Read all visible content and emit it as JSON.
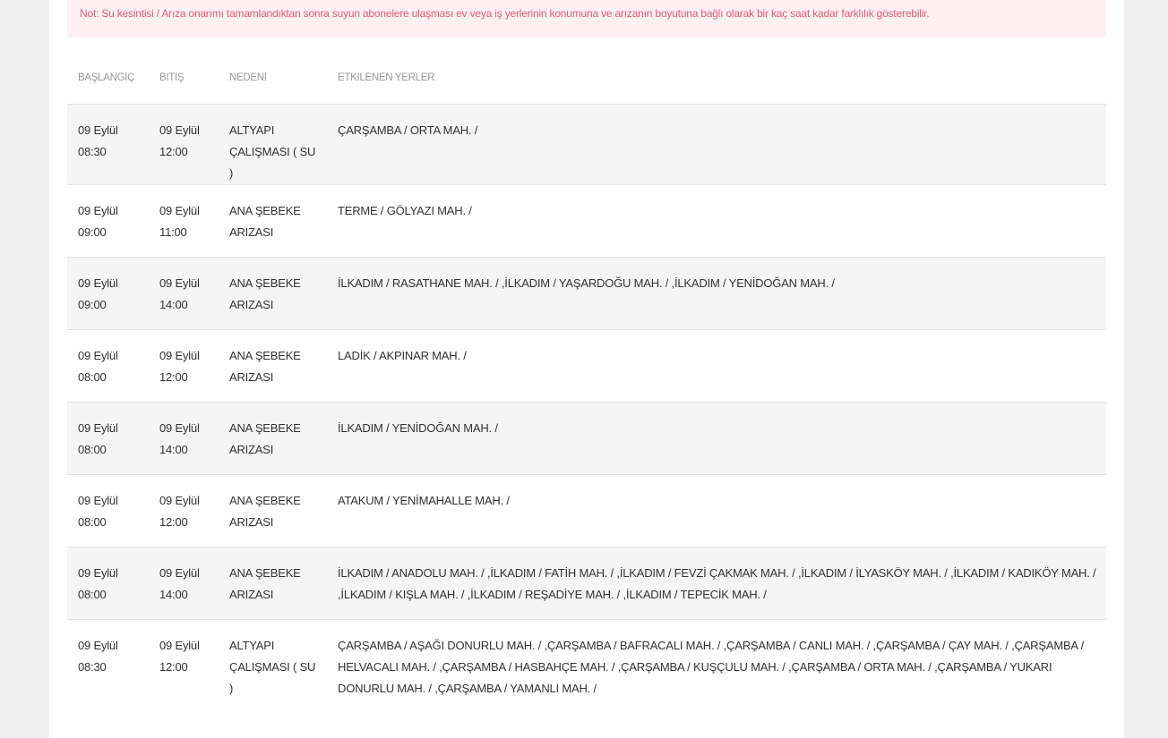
{
  "notice": {
    "text": "Not: Su kesintisi / Arıza onarımı tamamlandıktan sonra suyun abonelere ulaşması ev veya iş yerlerinin konumuna ve arızanın boyutuna bağlı olarak bir kaç saat kadar farklılık gösterebilir."
  },
  "table": {
    "headers": {
      "start": "BAŞLANGIÇ",
      "end": "BITIŞ",
      "reason": "NEDENI",
      "places": "ETKILENEN YERLER"
    },
    "rows": [
      {
        "start_date": "09 Eylül",
        "start_time": "08:30",
        "end_date": "09 Eylül",
        "end_time": "12:00",
        "reason_1": "ALTYAPI",
        "reason_2": "ÇALIŞMASI ( SU )",
        "places": "ÇARŞAMBA / ORTA MAH. /"
      },
      {
        "start_date": "09 Eylül",
        "start_time": "09:00",
        "end_date": "09 Eylül",
        "end_time": "11:00",
        "reason_1": "ANA ŞEBEKE",
        "reason_2": "ARIZASI",
        "places": "TERME / GÖLYAZI MAH. /"
      },
      {
        "start_date": "09 Eylül",
        "start_time": "09:00",
        "end_date": "09 Eylül",
        "end_time": "14:00",
        "reason_1": "ANA ŞEBEKE",
        "reason_2": "ARIZASI",
        "places": "İLKADIM / RASATHANE MAH. / ,İLKADIM / YAŞARDOĞU MAH. / ,İLKADIM / YENİDOĞAN MAH. /"
      },
      {
        "start_date": "09 Eylül",
        "start_time": "08:00",
        "end_date": "09 Eylül",
        "end_time": "12:00",
        "reason_1": "ANA ŞEBEKE",
        "reason_2": "ARIZASI",
        "places": "LADİK / AKPINAR MAH. /"
      },
      {
        "start_date": "09 Eylül",
        "start_time": "08:00",
        "end_date": "09 Eylül",
        "end_time": "14:00",
        "reason_1": "ANA ŞEBEKE",
        "reason_2": "ARIZASI",
        "places": "İLKADIM / YENİDOĞAN MAH. /"
      },
      {
        "start_date": "09 Eylül",
        "start_time": "08:00",
        "end_date": "09 Eylül",
        "end_time": "12:00",
        "reason_1": "ANA ŞEBEKE",
        "reason_2": "ARIZASI",
        "places": "ATAKUM / YENİMAHALLE MAH. /"
      },
      {
        "start_date": "09 Eylül",
        "start_time": "08:00",
        "end_date": "09 Eylül",
        "end_time": "14:00",
        "reason_1": "ANA ŞEBEKE",
        "reason_2": "ARIZASI",
        "places": "İLKADIM / ANADOLU MAH. / ,İLKADIM / FATİH MAH. / ,İLKADIM / FEVZİ ÇAKMAK MAH. / ,İLKADIM / İLYASKÖY MAH. / ,İLKADIM / KADIKÖY MAH. / ,İLKADIM / KIŞLA MAH. / ,İLKADIM / REŞADİYE MAH. / ,İLKADIM / TEPECİK MAH. /"
      },
      {
        "start_date": "09 Eylül",
        "start_time": "08:30",
        "end_date": "09 Eylül",
        "end_time": "12:00",
        "reason_1": "ALTYAPI",
        "reason_2": "ÇALIŞMASI ( SU )",
        "places": "ÇARŞAMBA / AŞAĞI DONURLU MAH. / ,ÇARŞAMBA / BAFRACALI MAH. / ,ÇARŞAMBA / CANLI MAH. / ,ÇARŞAMBA / ÇAY MAH. / ,ÇARŞAMBA / HELVACALI MAH. / ,ÇARŞAMBA / HASBAHÇE MAH. / ,ÇARŞAMBA / KUŞÇULU MAH. / ,ÇARŞAMBA / ORTA MAH. / ,ÇARŞAMBA / YUKARI DONURLU MAH. / ,ÇARŞAMBA / YAMANLI MAH. /"
      }
    ]
  }
}
